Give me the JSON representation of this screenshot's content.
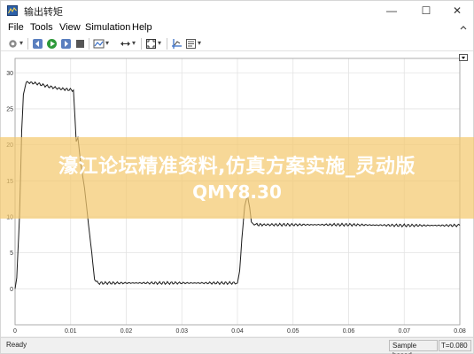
{
  "window": {
    "title": "输出转矩",
    "min_symbol": "—",
    "max_symbol": "☐",
    "close_symbol": "✕"
  },
  "menu": {
    "items": [
      "File",
      "Tools",
      "View",
      "Simulation",
      "Help"
    ]
  },
  "toolbar": {
    "icons": [
      "gear-icon",
      "stop-sim-icon",
      "run-icon",
      "step-forward-icon",
      "stop-icon",
      "highlight-icon",
      "zoom-icon",
      "fit-to-view-icon",
      "cursor-measure-icon",
      "properties-icon"
    ]
  },
  "status": {
    "ready": "Ready",
    "mode": "Sample based",
    "time": "T=0.080"
  },
  "watermark": {
    "line1": "濠江论坛精准资料,仿真方案实施_灵动版",
    "line2": "QMY8.30"
  },
  "colors": {
    "trace": "#1a1a1a",
    "grid": "#e3e3e3",
    "watermark_band": "#f4c96f"
  },
  "chart_data": {
    "type": "line",
    "xlim": [
      0,
      0.08
    ],
    "ylim": [
      -5,
      32
    ],
    "x_ticks": [
      "0",
      "0.01",
      "0.02",
      "0.03",
      "0.04",
      "0.05",
      "0.06",
      "0.07",
      "0.08"
    ],
    "y_ticks": [
      "0",
      "5",
      "10",
      "15",
      "20",
      "25",
      "30"
    ],
    "grid": true,
    "series": [
      {
        "x": [
          0,
          0.0003,
          0.0008,
          0.0012,
          0.0015,
          0.002,
          0.004,
          0.006,
          0.008,
          0.0105,
          0.011,
          0.0113,
          0.0118,
          0.0125,
          0.0132,
          0.0138,
          0.0143,
          0.015,
          0.02,
          0.025,
          0.03,
          0.035,
          0.04,
          0.0404,
          0.0408,
          0.0413,
          0.0418,
          0.0422,
          0.0425,
          0.0428,
          0.0435,
          0.045,
          0.05,
          0.06,
          0.07,
          0.08
        ],
        "y": [
          0,
          1.5,
          10,
          22,
          27,
          28.7,
          28.5,
          28.1,
          27.8,
          27.6,
          20.5,
          21,
          17.5,
          14,
          9,
          5,
          1.2,
          0.8,
          0.8,
          0.8,
          0.8,
          0.8,
          0.8,
          2.5,
          7,
          11.5,
          13,
          11.3,
          9.4,
          9,
          8.9,
          8.9,
          8.9,
          8.9,
          8.8,
          8.8
        ]
      }
    ]
  }
}
